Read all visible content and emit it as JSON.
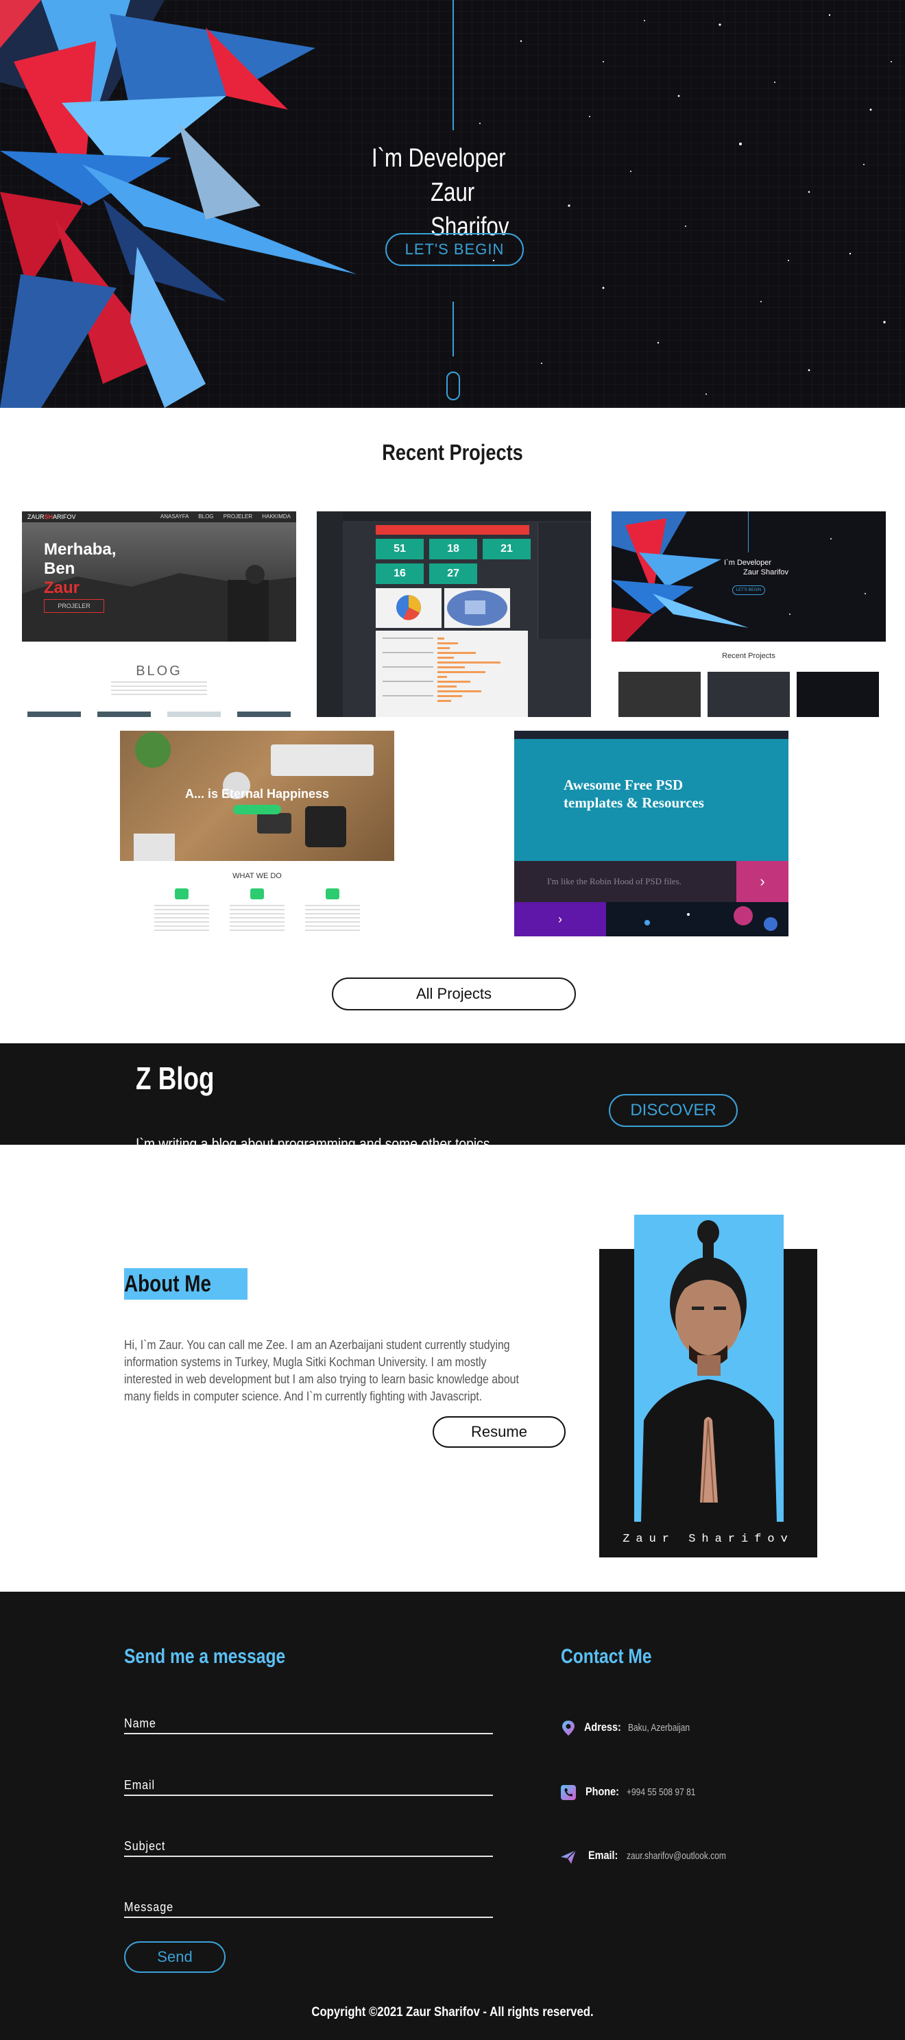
{
  "hero": {
    "line1": "I`m Developer",
    "line2": "Zaur Sharifov",
    "begin_label": "LET'S BEGIN",
    "accent": "#3aa2d8"
  },
  "projects": {
    "title": "Recent Projects",
    "all_label": "All Projects",
    "thumb1": {
      "logo_a": "ZAUR",
      "logo_b": "SH",
      "logo_c": "ARIFOV",
      "menu": "ANASAYFA BLOG PROJELER HAKKIMDA",
      "h1": "Merhaba,",
      "h2": "Ben",
      "h3": "Zaur",
      "button": "PROJELER",
      "blog": "BLOG"
    },
    "thumb2": {
      "cards": [
        "51",
        "18",
        "21",
        "16",
        "27"
      ]
    },
    "thumb3": {
      "line1": "I`m Developer",
      "line2": "Zaur Sharifov",
      "button": "LET'S BEGIN",
      "sub": "Recent Projects"
    },
    "thumb4": {
      "title": "A... is Eternal Happiness",
      "what": "WHAT WE DO"
    },
    "thumb5": {
      "h1": "Awesome Free PSD",
      "h2": "templates & Resources",
      "tag": "I'm like the Robin Hood of PSD files."
    }
  },
  "blog": {
    "title": "Z Blog",
    "text": "I`m writing a blog about programming and some other topics.",
    "discover_label": "DISCOVER"
  },
  "about": {
    "title": "About Me",
    "text": "Hi, I`m Zaur. You can call me Zee. I am an Azerbaijani student currently studying information systems in Turkey, Mugla Sitki Kochman University. I am mostly interested in web development but I am also trying to learn basic knowledge about many fields in computer science. And I`m currently fighting with Javascript.",
    "resume_label": "Resume",
    "photo_name": "Zaur Sharifov",
    "accent": "#5bc0f5"
  },
  "contact": {
    "form_title": "Send me a message",
    "fields": [
      "Name",
      "Email",
      "Subject",
      "Message"
    ],
    "send_label": "Send",
    "info_title": "Contact Me",
    "address_label": "Adress:",
    "address_value": "Baku, Azerbaijan",
    "phone_label": "Phone:",
    "phone_value": "+994 55 508 97 81",
    "email_label": "Email:",
    "email_value": "zaur.sharifov@outlook.com",
    "icons": [
      "location-pin-icon",
      "phone-icon",
      "paper-plane-icon"
    ],
    "copyright": "Copyright ©2021 Zaur Sharifov - All rights reserved."
  }
}
